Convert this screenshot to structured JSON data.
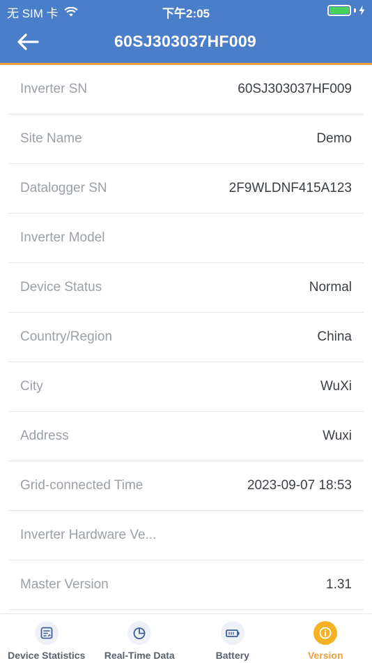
{
  "status_bar": {
    "carrier": "无 SIM 卡",
    "time": "下午2:05",
    "wifi_icon": "wifi-icon",
    "battery_icon": "battery-icon"
  },
  "header": {
    "title": "60SJ303037HF009",
    "back_icon": "arrow-left-icon",
    "accent_color": "#4a7ec9",
    "underline_color": "#f0a13a"
  },
  "details": [
    {
      "label": "Inverter SN",
      "value": "60SJ303037HF009"
    },
    {
      "label": "Site Name",
      "value": "Demo"
    },
    {
      "label": "Datalogger SN",
      "value": "2F9WLDNF415A123"
    },
    {
      "label": "Inverter Model",
      "value": ""
    },
    {
      "label": "Device Status",
      "value": "Normal"
    },
    {
      "label": "Country/Region",
      "value": "China"
    },
    {
      "label": "City",
      "value": "WuXi"
    },
    {
      "label": "Address",
      "value": "Wuxi"
    },
    {
      "label": "Grid-connected Time",
      "value": "2023-09-07 18:53"
    },
    {
      "label": "Inverter Hardware Ve...",
      "value": ""
    },
    {
      "label": "Master Version",
      "value": "1.31"
    }
  ],
  "tabs": [
    {
      "label": "Device Statistics",
      "icon": "statistics-icon",
      "active": false
    },
    {
      "label": "Real-Time Data",
      "icon": "pie-chart-icon",
      "active": false
    },
    {
      "label": "Battery",
      "icon": "battery-icon",
      "active": false
    },
    {
      "label": "Version",
      "icon": "info-icon",
      "active": true
    }
  ],
  "colors": {
    "active_tab": "#f0a13a",
    "battery_level": "#4ad25b"
  }
}
